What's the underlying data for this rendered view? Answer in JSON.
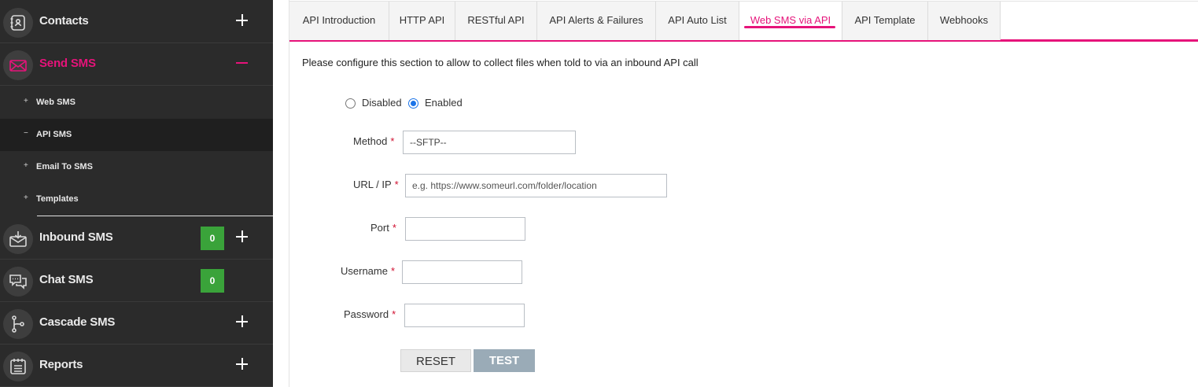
{
  "sidebar": {
    "contacts": {
      "label": "Contacts",
      "icon": "contacts-book-icon"
    },
    "send_sms": {
      "label": "Send SMS",
      "icon": "envelope-icon",
      "sub_items": [
        {
          "bullet": "+",
          "label": "Web SMS"
        },
        {
          "bullet": "−",
          "label": "API SMS"
        },
        {
          "bullet": "+",
          "label": "Email To SMS"
        },
        {
          "bullet": "+",
          "label": "Templates"
        }
      ]
    },
    "inbound_sms": {
      "label": "Inbound SMS",
      "icon": "inbox-download-icon",
      "badge": "0"
    },
    "chat_sms": {
      "label": "Chat SMS",
      "icon": "chat-bubbles-icon",
      "badge": "0"
    },
    "cascade_sms": {
      "label": "Cascade SMS",
      "icon": "branch-icon"
    },
    "reports": {
      "label": "Reports",
      "icon": "report-list-icon"
    }
  },
  "tabs": [
    {
      "label": "API Introduction"
    },
    {
      "label": "HTTP API"
    },
    {
      "label": "RESTful API"
    },
    {
      "label": "API Alerts & Failures"
    },
    {
      "label": "API Auto List"
    },
    {
      "label": "Web SMS via API",
      "active": true
    },
    {
      "label": "API Template"
    },
    {
      "label": "Webhooks"
    }
  ],
  "form": {
    "intro": "Please configure this section to allow to collect files when told to via an inbound API call",
    "radio_disabled": "Disabled",
    "radio_enabled": "Enabled",
    "selected": "Enabled",
    "method_label": "Method",
    "method_value": "--SFTP--",
    "url_label": "URL / IP",
    "url_placeholder": "e.g. https://www.someurl.com/folder/location",
    "port_label": "Port",
    "username_label": "Username",
    "password_label": "Password",
    "required_mark": "*",
    "reset_label": "RESET",
    "test_label": "TEST"
  },
  "colors": {
    "accent": "#e6137a",
    "sidebar_bg": "#2b2b2b",
    "badge_green": "#3aa33a",
    "test_button": "#9aabb7"
  }
}
